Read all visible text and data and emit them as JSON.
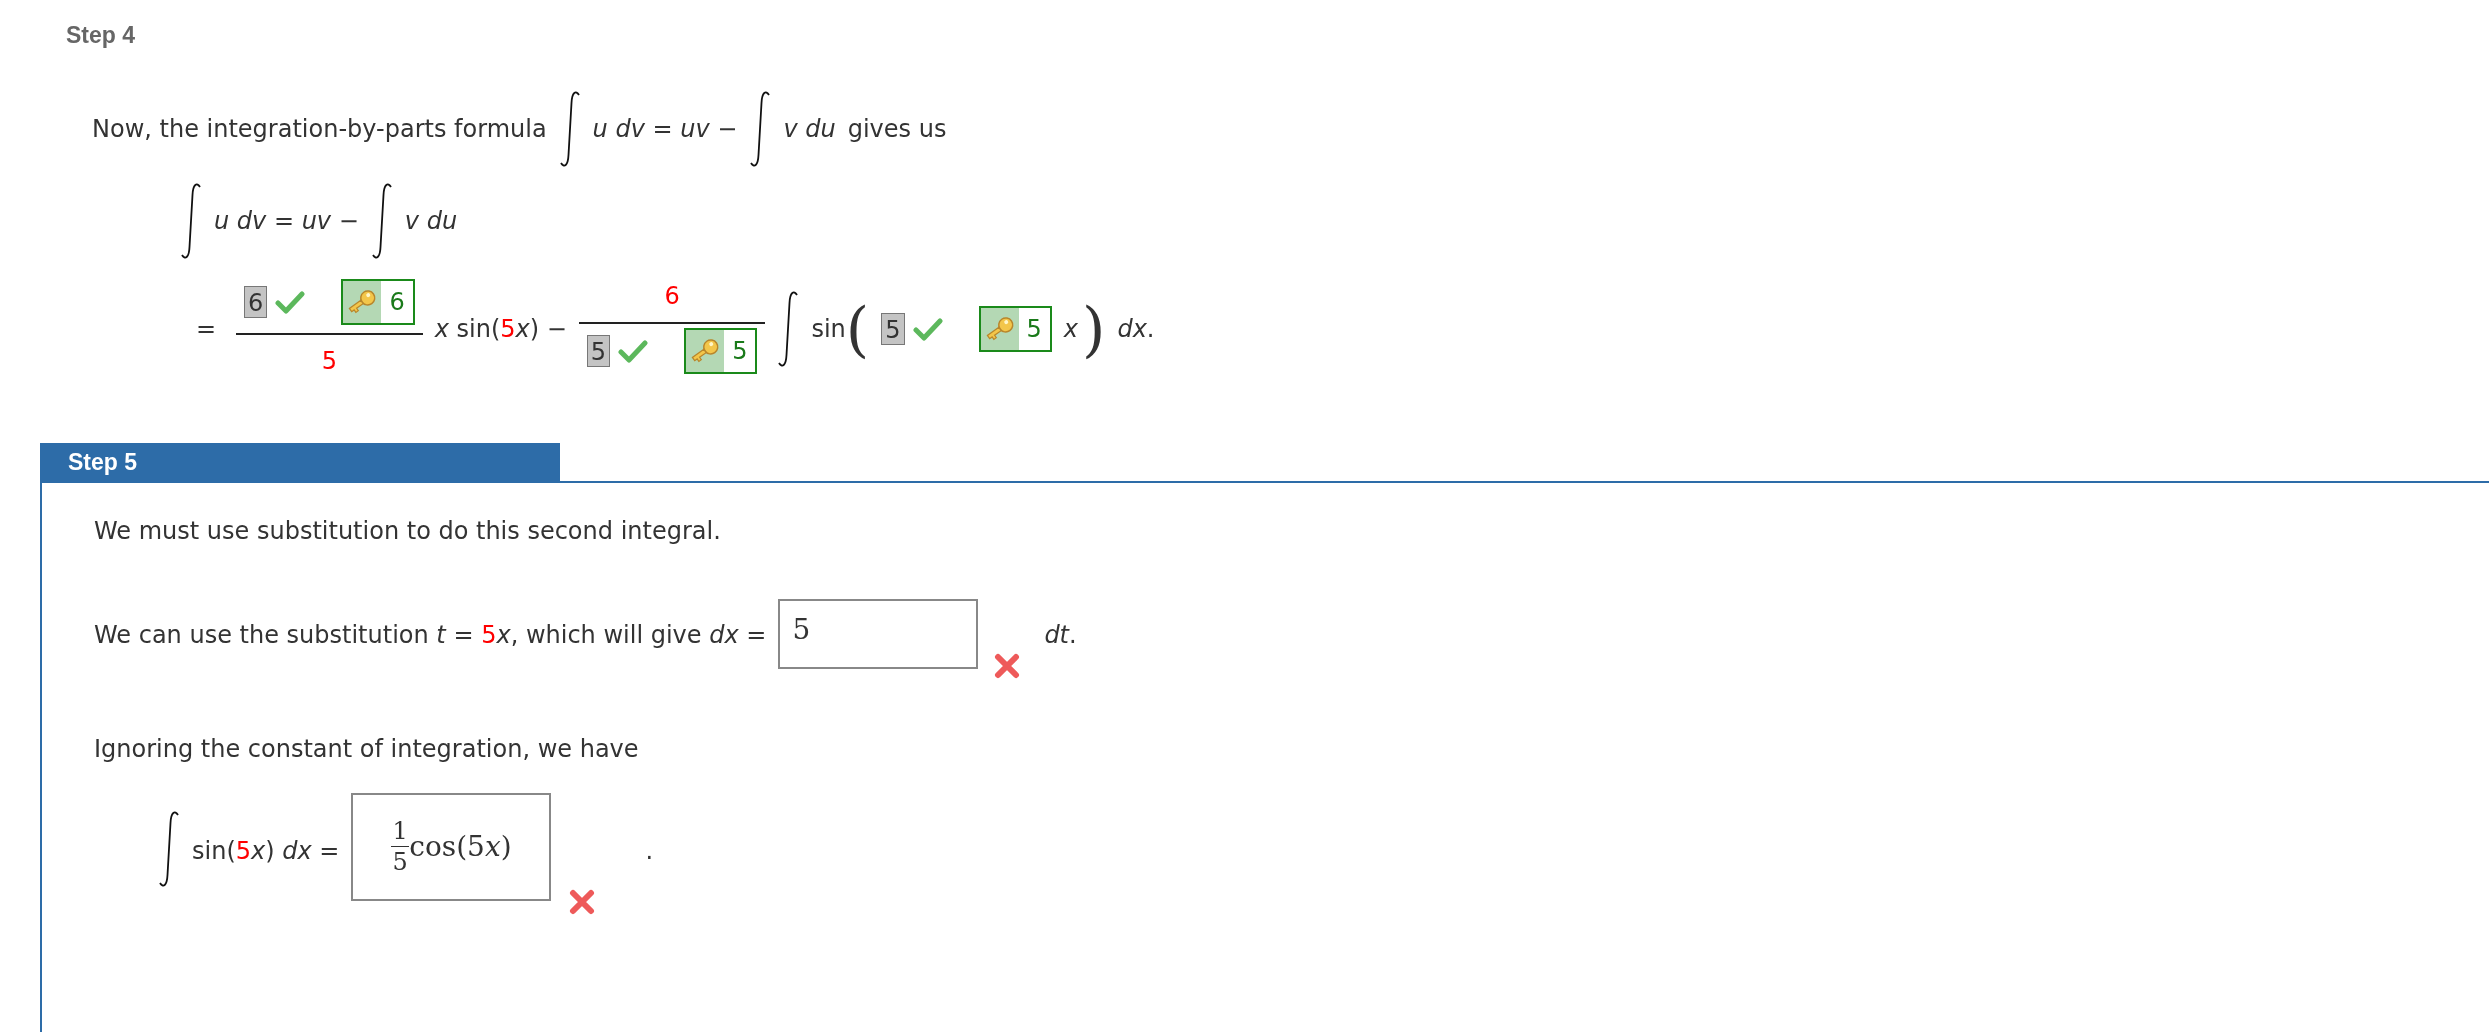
{
  "step4": {
    "title": "Step 4",
    "intro": {
      "before": "Now, the integration-by-parts formula",
      "lhs": [
        {
          "t": "u dv",
          "kind": "italic"
        },
        {
          "t": " = ",
          "kind": "plain"
        },
        {
          "t": "uv",
          "kind": "italic"
        },
        {
          "t": " −",
          "kind": "plain"
        }
      ],
      "rhs": [
        {
          "t": "v du",
          "kind": "italic"
        }
      ],
      "after": "gives us"
    },
    "formula": {
      "lhs": [
        {
          "t": "u dv",
          "kind": "italic"
        },
        {
          "t": " = ",
          "kind": "plain"
        },
        {
          "t": "uv",
          "kind": "italic"
        },
        {
          "t": " −",
          "kind": "plain"
        }
      ],
      "rhs": [
        {
          "t": "v du",
          "kind": "italic"
        }
      ]
    },
    "result": {
      "equals": "=",
      "fraction_1": {
        "numerator": {
          "value": "6",
          "correct": true,
          "key": "6"
        },
        "denominator": "5"
      },
      "middle": [
        {
          "t": "x",
          "kind": "italic"
        },
        {
          "t": " sin(",
          "kind": "plain"
        },
        {
          "t": "5",
          "kind": "red"
        },
        {
          "t": "x",
          "kind": "italic"
        },
        {
          "t": ") −",
          "kind": "plain"
        }
      ],
      "fraction_2": {
        "numerator": "6",
        "denominator": {
          "value": "5",
          "correct": true,
          "key": "5"
        }
      },
      "func": "sin",
      "open_paren": "(",
      "argument": {
        "value": "5",
        "correct": true,
        "key": "5"
      },
      "argument_var": [
        {
          "t": "x",
          "kind": "italic"
        }
      ],
      "close_paren": ")",
      "tail": [
        {
          "t": "dx",
          "kind": "italic"
        },
        {
          "t": ".",
          "kind": "plain"
        }
      ]
    }
  },
  "step5": {
    "title": "Step 5",
    "sentence_1": "We must use substitution to do this second integral.",
    "sentence_2": [
      {
        "t": "We can use the substitution ",
        "kind": "plain"
      },
      {
        "t": "t",
        "kind": "italic"
      },
      {
        "t": " = ",
        "kind": "plain"
      },
      {
        "t": "5",
        "kind": "red"
      },
      {
        "t": "x",
        "kind": "italic"
      },
      {
        "t": ", which will give ",
        "kind": "plain"
      },
      {
        "t": "dx",
        "kind": "italic"
      },
      {
        "t": " =",
        "kind": "plain"
      }
    ],
    "input_1": {
      "value": "5",
      "correct": false
    },
    "after_input_1": [
      {
        "t": "dt",
        "kind": "italic"
      },
      {
        "t": ".",
        "kind": "plain"
      }
    ],
    "sentence_3": "Ignoring the constant of integration, we have",
    "integral": [
      {
        "t": "sin(",
        "kind": "plain"
      },
      {
        "t": "5",
        "kind": "red"
      },
      {
        "t": "x",
        "kind": "italic"
      },
      {
        "t": ") ",
        "kind": "plain"
      },
      {
        "t": "dx",
        "kind": "italic"
      },
      {
        "t": " =",
        "kind": "plain"
      }
    ],
    "input_2": {
      "numerator": "1",
      "denominator": "5",
      "rest": [
        {
          "t": "cos",
          "kind": "plain"
        },
        {
          "t": "(",
          "kind": "plain"
        },
        {
          "t": "5",
          "kind": "plain"
        },
        {
          "t": "x",
          "kind": "italic"
        },
        {
          "t": ")",
          "kind": "plain"
        }
      ],
      "correct": false
    },
    "end": "."
  }
}
